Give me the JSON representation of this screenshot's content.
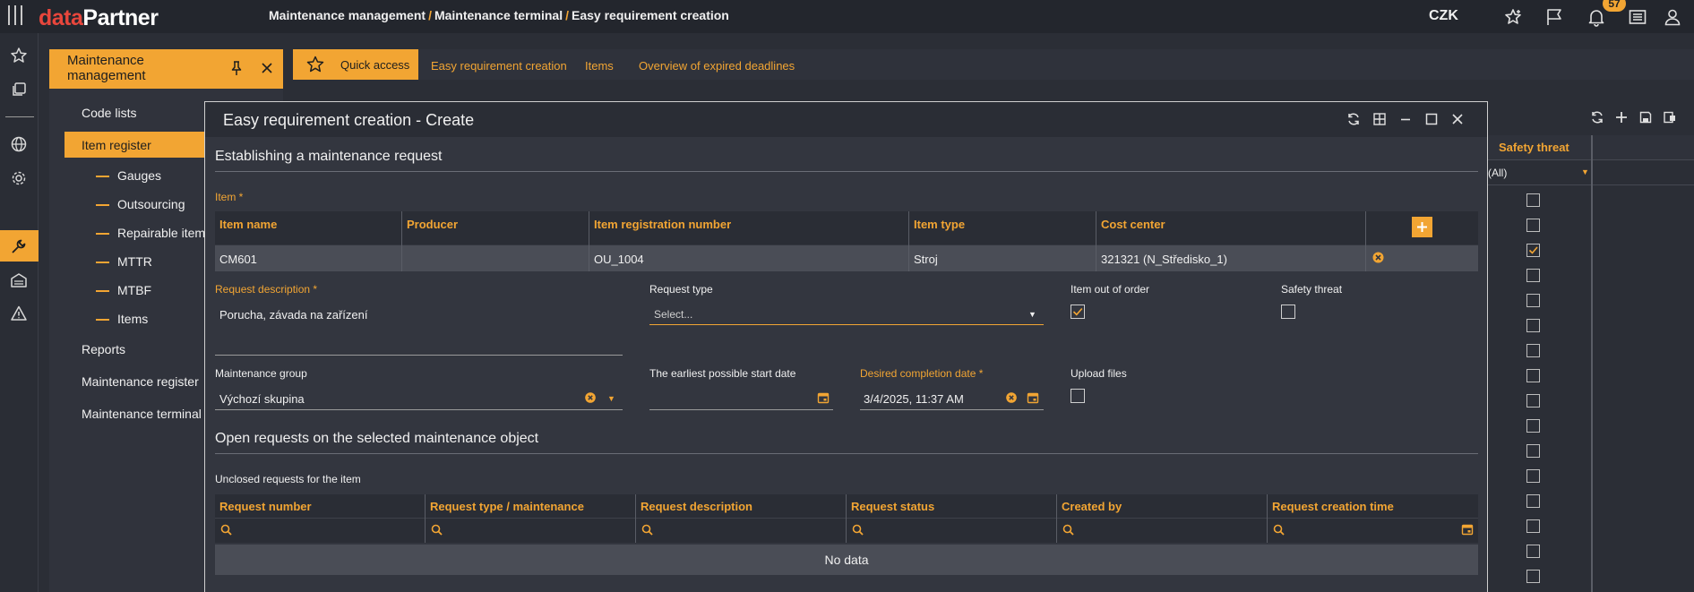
{
  "app": {
    "logo_part1": "data",
    "logo_part2": "Partner",
    "currency": "CZK",
    "notification_count": "57"
  },
  "breadcrumb": [
    "Maintenance management",
    "Maintenance terminal",
    "Easy requirement creation"
  ],
  "menu": {
    "title": "Maintenance management",
    "items": [
      {
        "label": "Code lists"
      },
      {
        "label": "Item register"
      },
      {
        "label": "Gauges"
      },
      {
        "label": "Outsourcing"
      },
      {
        "label": "Repairable item"
      },
      {
        "label": "MTTR"
      },
      {
        "label": "MTBF"
      },
      {
        "label": "Items"
      },
      {
        "label": "Reports"
      },
      {
        "label": "Maintenance register"
      },
      {
        "label": "Maintenance terminal"
      }
    ]
  },
  "tabs": [
    "Quick access",
    "Easy requirement creation",
    "Items",
    "Overview of expired deadlines"
  ],
  "background_grid": {
    "column_header": "Safety threat",
    "filter_value": "(All)"
  },
  "modal": {
    "title": "Easy requirement creation - Create",
    "section1": "Establishing a maintenance request",
    "item_label": "Item *",
    "item_table": {
      "columns": [
        "Item name",
        "Producer",
        "Item registration number",
        "Item type",
        "Cost center"
      ],
      "row": [
        "CM601",
        "",
        "OU_1004",
        "Stroj",
        "321321 (N_Středisko_1)"
      ]
    },
    "request_description": {
      "label": "Request description *",
      "value": "Porucha, závada na zařízení"
    },
    "request_type": {
      "label": "Request type",
      "placeholder": "Select..."
    },
    "item_out_of_order": {
      "label": "Item out of order",
      "checked": true
    },
    "safety_threat": {
      "label": "Safety threat",
      "checked": false
    },
    "maintenance_group": {
      "label": "Maintenance group",
      "value": "Výchozí skupina"
    },
    "earliest_start": {
      "label": "The earliest possible start date",
      "value": ""
    },
    "desired_completion": {
      "label": "Desired completion date *",
      "value": "3/4/2025, 11:37 AM"
    },
    "upload_files": {
      "label": "Upload files",
      "checked": false
    },
    "section2": "Open requests on the selected maintenance object",
    "unclosed_label": "Unclosed requests for the item",
    "requests_table": {
      "columns": [
        "Request number",
        "Request type / maintenance",
        "Request description",
        "Request status",
        "Created by",
        "Request creation time"
      ],
      "empty_text": "No data"
    }
  },
  "colors": {
    "accent": "#f2a533",
    "brand_red": "#e8463c",
    "background": "#2b2e36",
    "modal": "#33363f"
  }
}
